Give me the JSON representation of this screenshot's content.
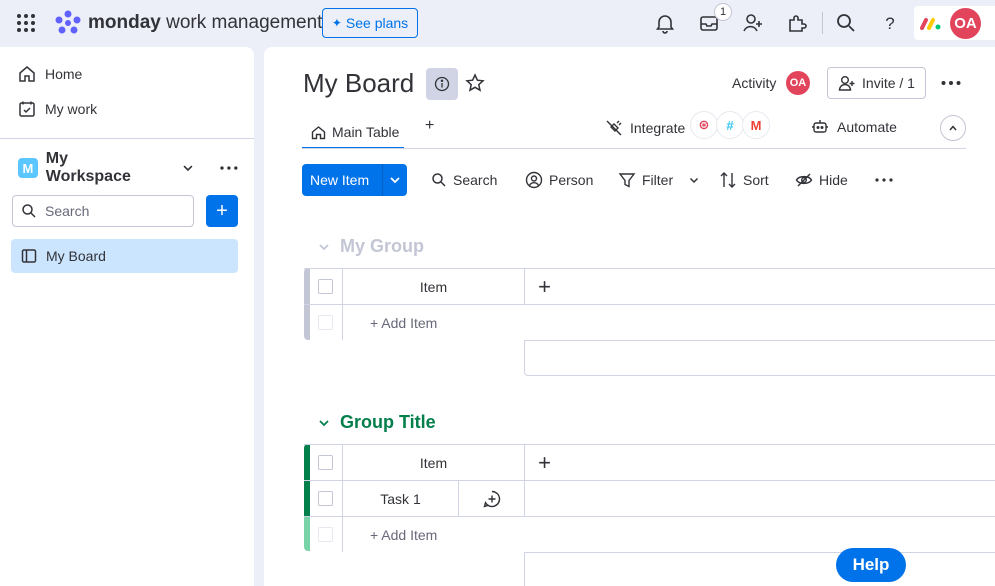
{
  "topbar": {
    "brand_bold": "monday",
    "brand_rest": "work management",
    "see_plans": "See plans",
    "inbox_count": "1",
    "avatar_initials": "OA"
  },
  "sidebar": {
    "items": [
      {
        "label": "Home",
        "icon": "home-icon"
      },
      {
        "label": "My work",
        "icon": "my-work-icon"
      }
    ],
    "workspace": {
      "badge": "M",
      "name": "My Workspace"
    },
    "search_placeholder": "Search",
    "add_label": "+",
    "boards": [
      {
        "label": "My Board"
      }
    ]
  },
  "board": {
    "title": "My Board",
    "activity_label": "Activity",
    "activity_avatar": "OA",
    "invite_label": "Invite / 1",
    "tabs": [
      {
        "label": "Main Table"
      }
    ],
    "add_tab": "+",
    "integrate_label": "Integrate",
    "automate_label": "Automate",
    "integration_icons": [
      "webhook-icon",
      "slack-icon",
      "gmail-icon"
    ]
  },
  "toolbar": {
    "new_item": "New Item",
    "search": "Search",
    "person": "Person",
    "filter": "Filter",
    "sort": "Sort",
    "hide": "Hide"
  },
  "groups": [
    {
      "title": "My Group",
      "color": "#c3c6d4",
      "column_item": "Item",
      "add_item": "+ Add Item",
      "rows": []
    },
    {
      "title": "Group Title",
      "color": "#037f4c",
      "column_item": "Item",
      "add_item": "+ Add Item",
      "rows": [
        {
          "name": "Task 1"
        }
      ]
    }
  ],
  "help_label": "Help",
  "colors": {
    "primary": "#0073ea",
    "avatar": "#e2445c",
    "selected": "#cce5ff",
    "group2": "#037f4c"
  }
}
